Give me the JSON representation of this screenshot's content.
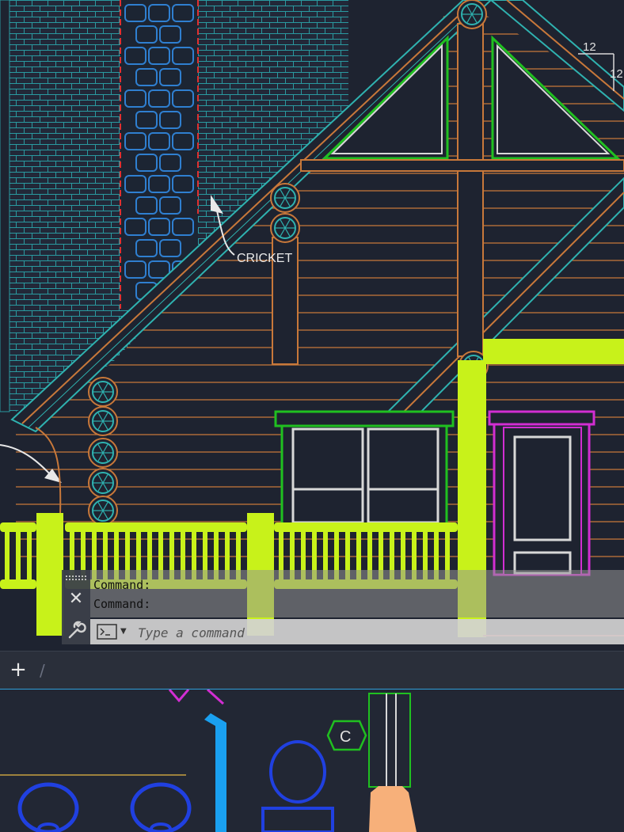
{
  "drawing": {
    "annotation_cricket": "CRICKET",
    "roof_pitch_run": "12",
    "roof_pitch_rise": "12",
    "section_marker_label": "C"
  },
  "command_window": {
    "history": [
      "Command:",
      "Command:"
    ],
    "input_placeholder": "Type a command",
    "close_glyph": "✕"
  },
  "layout_tabs": {
    "add_glyph": "+",
    "separator_glyph": "/"
  },
  "colors": {
    "background": "#1e2330",
    "lime": "#c8f21a",
    "orange": "#c8783a",
    "cyan": "#2fb2b0",
    "green": "#20c020",
    "magenta": "#d22ed2",
    "blue": "#2040e0",
    "red": "#e03030"
  },
  "icons": {
    "close": "close-icon",
    "customize": "wrench-icon",
    "prompt": "command-line-icon",
    "add_layout": "plus-icon"
  }
}
